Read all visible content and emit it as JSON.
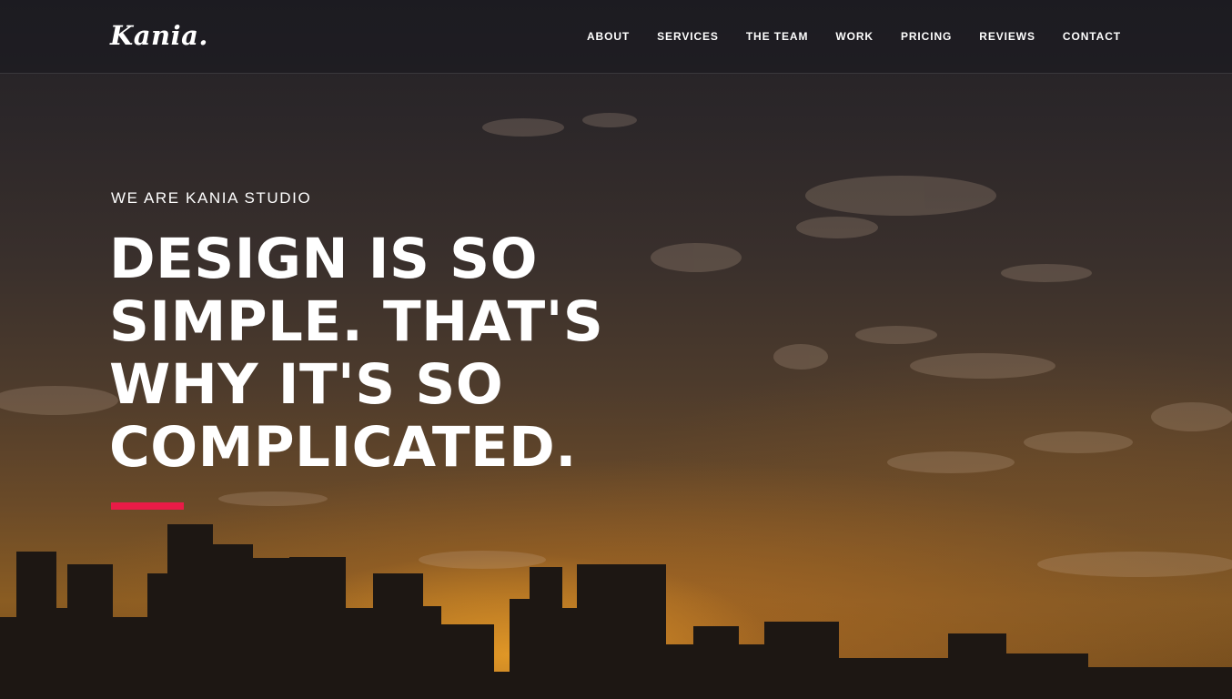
{
  "header": {
    "logo": "Kania.",
    "nav": [
      "About",
      "Services",
      "The Team",
      "Work",
      "Pricing",
      "Reviews",
      "Contact"
    ]
  },
  "hero": {
    "eyebrow": "We are Kania Studio",
    "headline_lines": [
      "Design is so",
      "simple. That's",
      "why it's so",
      "complicated."
    ]
  },
  "colors": {
    "accent": "#e91b47",
    "text": "#ffffff"
  }
}
